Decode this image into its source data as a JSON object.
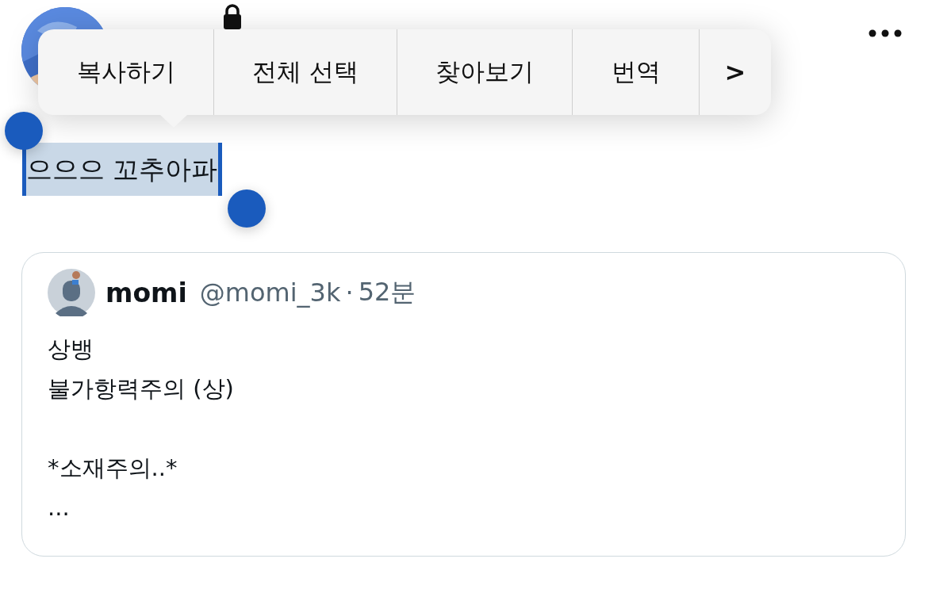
{
  "post": {
    "text": "으으으 꼬추아파",
    "selected": true
  },
  "context_menu": {
    "items": [
      {
        "label": "복사하기"
      },
      {
        "label": "전체 선택"
      },
      {
        "label": "찾아보기"
      },
      {
        "label": "번역"
      },
      {
        "label": ">"
      }
    ]
  },
  "quote": {
    "name": "momi",
    "handle": "@momi_3k",
    "separator": "·",
    "time": "52분",
    "paragraphs": [
      [
        "상뱅",
        "불가항력주의 (상)"
      ],
      [
        "*소재주의..*",
        "..."
      ]
    ]
  }
}
